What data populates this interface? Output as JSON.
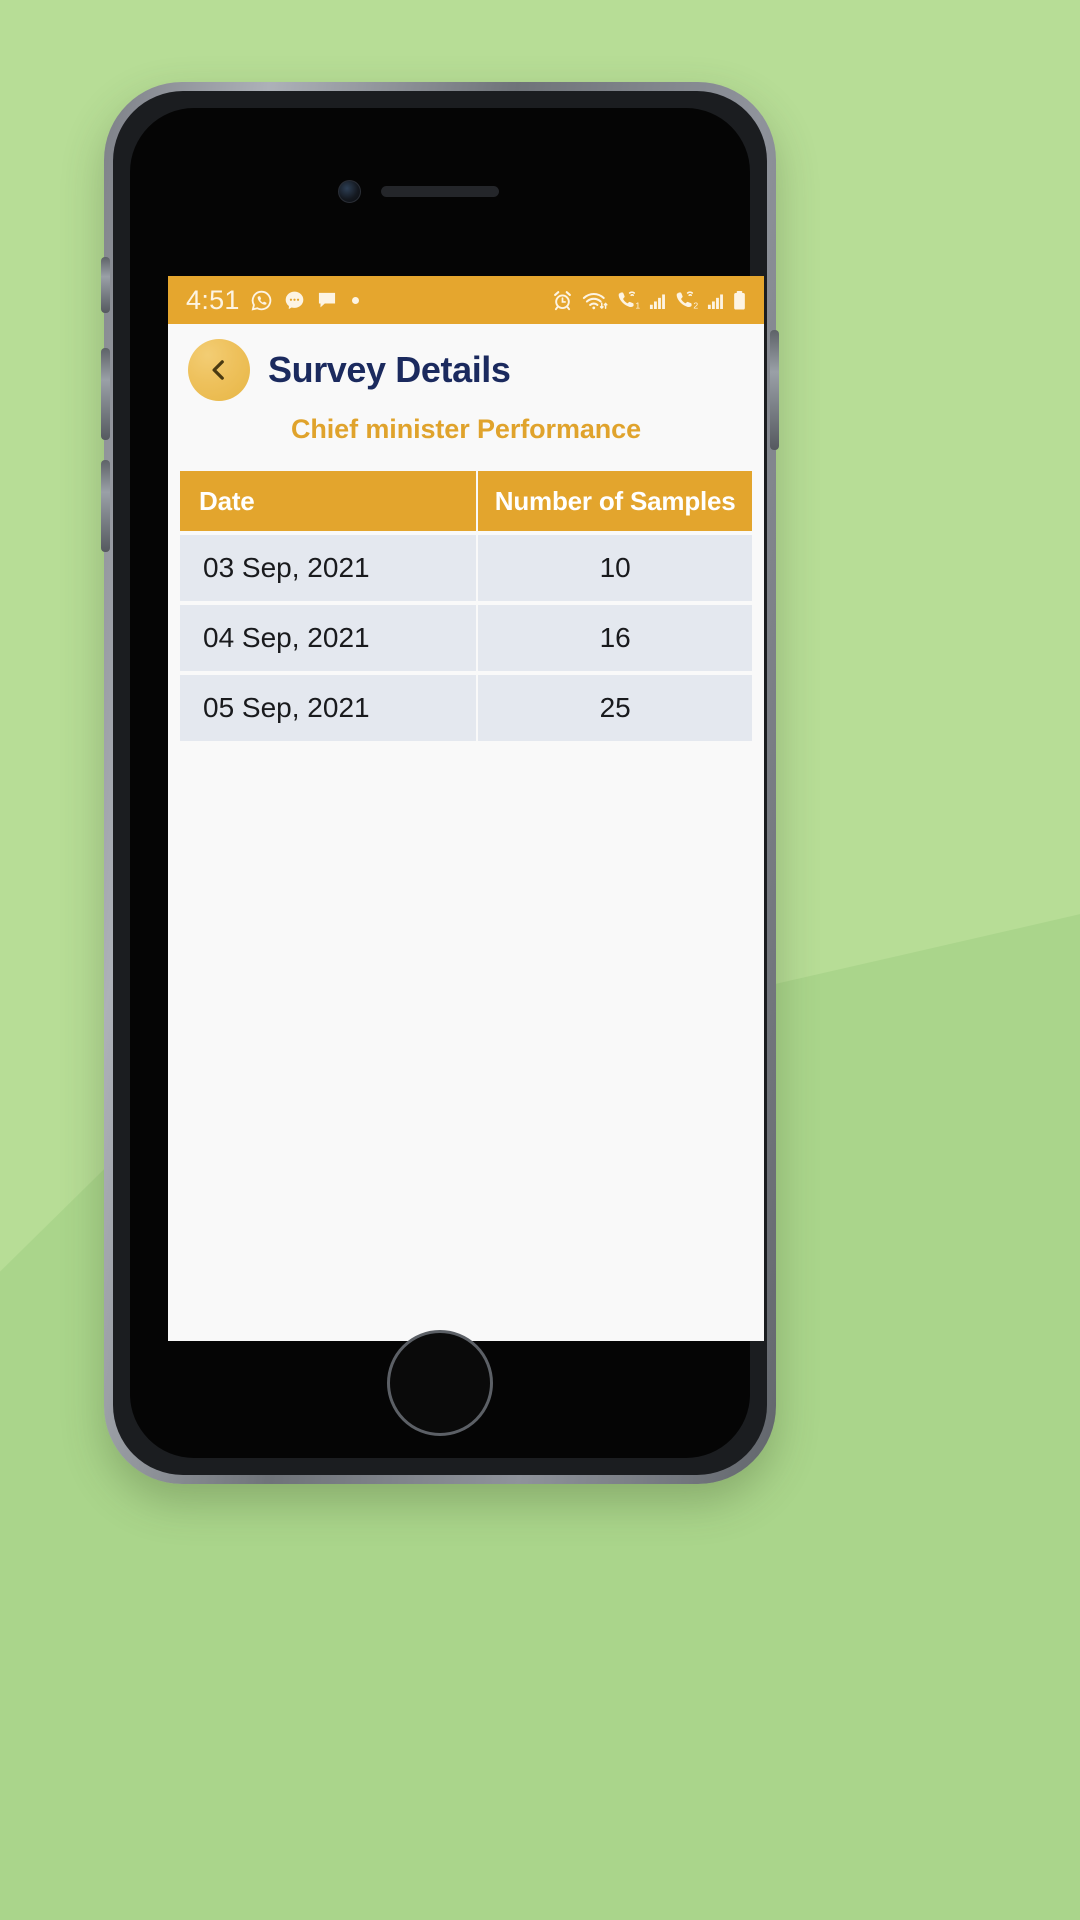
{
  "statusbar": {
    "time": "4:51",
    "left_icons": [
      "whatsapp-icon",
      "messenger-icon",
      "sms-icon",
      "notification-dot"
    ],
    "right_icons": [
      "alarm-icon",
      "wifi-icon",
      "call-sim1-icon",
      "signal-sim1-icon",
      "call-sim2-icon",
      "signal-sim2-icon",
      "battery-icon"
    ],
    "sim1_label": "1",
    "sim2_label": "2"
  },
  "appbar": {
    "back_icon": "chevron-left-icon",
    "title": "Survey Details"
  },
  "survey": {
    "name": "Chief minister Performance"
  },
  "table": {
    "headers": [
      "Date",
      "Number of Samples"
    ],
    "rows": [
      {
        "date": "03 Sep, 2021",
        "samples": "10"
      },
      {
        "date": "04 Sep, 2021",
        "samples": "16"
      },
      {
        "date": "05 Sep, 2021",
        "samples": "25"
      }
    ]
  },
  "colors": {
    "accent_orange": "#e3a52d",
    "status_bar": "#e5a62e",
    "title_navy": "#1b2a5e",
    "survey_gold": "#e0a32c",
    "row_bg": "#e4e8ef",
    "screen_bg": "#f9f9f9",
    "backdrop_green": "#b7dd96"
  }
}
